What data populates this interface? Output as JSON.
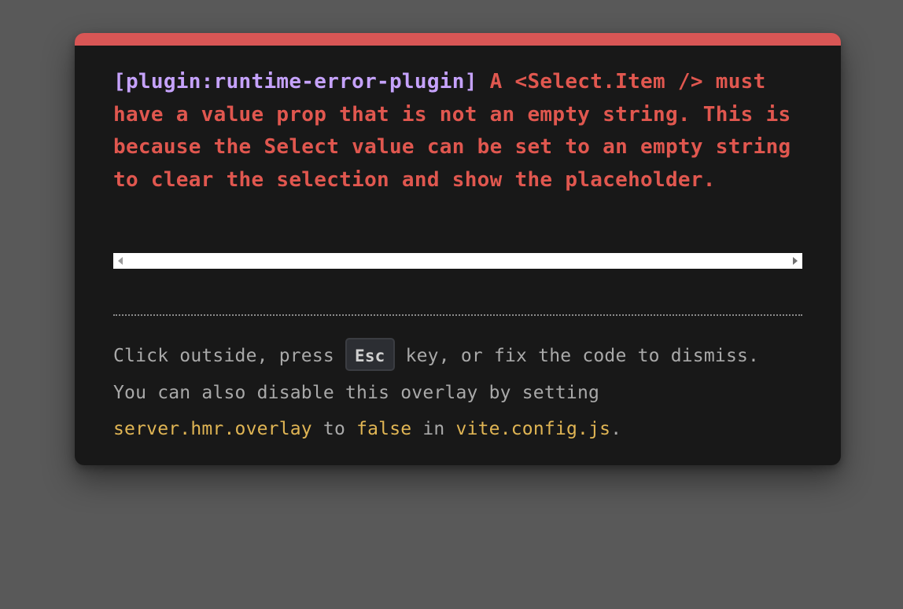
{
  "overlay": {
    "plugin": "[plugin:runtime-error-plugin]",
    "message": " A <Select.Item /> must have a value prop that is not an empty string. This is because the Select value can be set to an empty string to clear the selection and show the placeholder."
  },
  "tip": {
    "text_1": "Click outside, press ",
    "key": "Esc",
    "text_2": " key, or fix the code to dismiss.",
    "text_3": "You can also disable this overlay by setting",
    "code_1": "server.hmr.overlay",
    "text_4": " to ",
    "code_2": "false",
    "text_5": " in ",
    "code_3": "vite.config.js",
    "text_6": "."
  },
  "colors": {
    "accent_bar": "#d85655",
    "error_text": "#e0574f",
    "plugin_text": "#c5a2fb",
    "code_text": "#e0b554",
    "backdrop": "#595959",
    "window_bg": "#181818"
  },
  "icons": {
    "scroll_left": "scroll-left-arrow-icon",
    "scroll_right": "scroll-right-arrow-icon"
  }
}
